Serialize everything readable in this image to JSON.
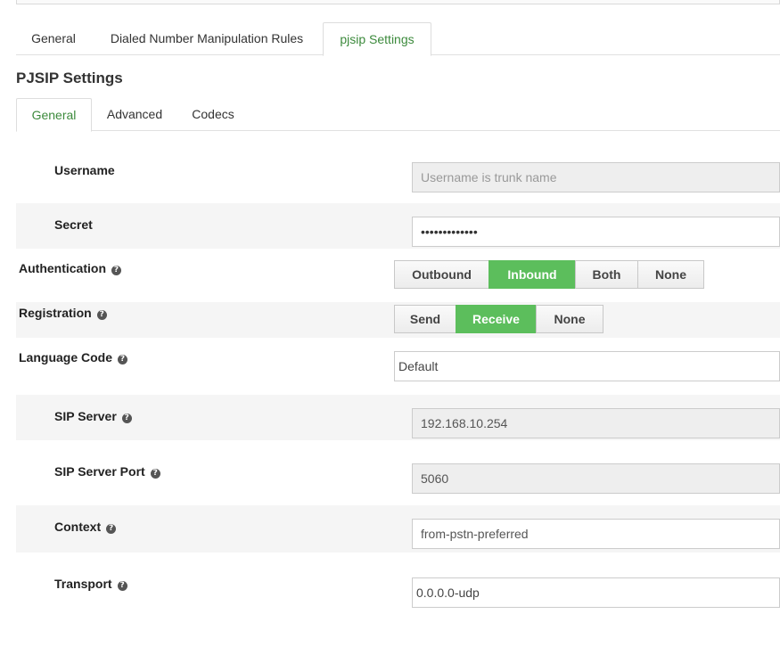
{
  "outer_tabs": [
    {
      "label": "General",
      "active": false
    },
    {
      "label": "Dialed Number Manipulation Rules",
      "active": false
    },
    {
      "label": "pjsip Settings",
      "active": true
    }
  ],
  "section_title": "PJSIP Settings",
  "inner_tabs": [
    {
      "label": "General",
      "active": true
    },
    {
      "label": "Advanced",
      "active": false
    },
    {
      "label": "Codecs",
      "active": false
    }
  ],
  "form": {
    "username": {
      "label": "Username",
      "placeholder": "Username is trunk name",
      "value": ""
    },
    "secret": {
      "label": "Secret",
      "value": "•••••••••••••"
    },
    "authentication": {
      "label": "Authentication",
      "options": [
        "Outbound",
        "Inbound",
        "Both",
        "None"
      ],
      "selected": "Inbound"
    },
    "registration": {
      "label": "Registration",
      "options": [
        "Send",
        "Receive",
        "None"
      ],
      "selected": "Receive"
    },
    "language_code": {
      "label": "Language Code",
      "value": "Default"
    },
    "sip_server": {
      "label": "SIP Server",
      "value": "192.168.10.254"
    },
    "sip_server_port": {
      "label": "SIP Server Port",
      "value": "5060"
    },
    "context": {
      "label": "Context",
      "value": "from-pstn-preferred"
    },
    "transport": {
      "label": "Transport",
      "value": "0.0.0.0-udp"
    }
  },
  "help_glyph": "?",
  "colors": {
    "accent_green": "#5cbe5c",
    "active_tab_text": "#3c8a3c",
    "row_stripe": "#f5f5f5",
    "readonly_bg": "#eeeeee"
  }
}
